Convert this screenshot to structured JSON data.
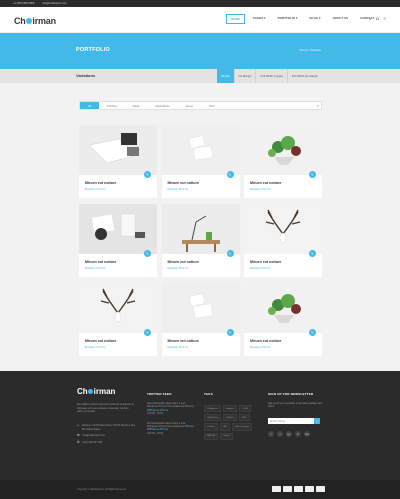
{
  "topbar": {
    "phone": "+1 (567) 890 0909",
    "email": "info@mailexport.com"
  },
  "header": {
    "logo_pre": "Ch",
    "logo_post": "irman",
    "nav": [
      "HOME",
      "PAGES ▾",
      "PORTFOLIO ▾",
      "BLOG ▾",
      "ABOUT US",
      "CONTACT"
    ],
    "icons": [
      "search-icon",
      "cart-icon",
      "menu-icon"
    ]
  },
  "hero": {
    "title": "PORTFOLIO",
    "breadcrumb": "Home  /  Portfolio"
  },
  "subbar": {
    "title": "Variations",
    "tabs": [
      "Simple",
      "No Margin",
      "Full Width Images",
      "Full Width No Margin"
    ]
  },
  "filters": {
    "items": [
      "All",
      "Printing",
      "Ideas",
      "Illustrations",
      "Home",
      "Pcer"
    ],
    "active": 0
  },
  "cards": [
    {
      "title": "Miruen eut notiure",
      "meta": "Branding  /  Print Yer",
      "img": "book"
    },
    {
      "title": "Miruen eut notiure",
      "meta": "Branding  /  Print Yer",
      "img": "cards"
    },
    {
      "title": "Miruen eut notiure",
      "meta": "Branding  /  Print Yer",
      "img": "plants"
    },
    {
      "title": "Miruen eut notiure",
      "meta": "Branding  /  Print Yer",
      "img": "desk"
    },
    {
      "title": "Miruen eut notiure",
      "meta": "Branding  /  Print Yer",
      "img": "lamp"
    },
    {
      "title": "Miruen eut notiure",
      "meta": "Branding  /  Print Yer",
      "img": "antlers"
    },
    {
      "title": "Miruen eut notiure",
      "meta": "Branding  /  Print Yer",
      "img": "antlers"
    },
    {
      "title": "Miruen eut notiure",
      "meta": "Branding  /  Print Yer",
      "img": "cards"
    },
    {
      "title": "Miruen eut notiure",
      "meta": "Branding  /  Print Yer",
      "img": "plants"
    }
  ],
  "footer": {
    "logo_pre": "Ch",
    "logo_post": "irman",
    "about": "Deu adipisi nvenies feaki etem ludus do lecpitenad. In vulputate velit esse molestie consequat, vel illum dolore eu feugiat.",
    "address": "Address : No.66 Sipto Stree/ CS123 Myorfreo City, WL United States",
    "email": "info@mailexport.com",
    "phone": "(101) 900 567 989",
    "col_tweets": "TWITTER FEED",
    "tweets": [
      {
        "text": "Microsoft Ecotific about pibno a new Wordpress Theme Here Attikoumut",
        "link": "#Timony #WPtheme #Theme",
        "date": "JAN 06 - 16:54"
      },
      {
        "text": "Microsoft Ecotific about pibno a new Wordpress Theme Here Attikoumut",
        "link": "#Timony #WPtheme #Theme",
        "date": "JAN 06 - 16:54"
      }
    ],
    "col_tags": "TAGS",
    "tags": [
      "Wordpress",
      "ambient",
      "CSS3",
      "WordPress",
      "HTML5",
      "PHP",
      "winGen",
      "UM",
      "Online Shoppe",
      "MAGPA",
      "Online"
    ],
    "col_news": "SIGN UP FOR NEWSLETTER",
    "news_text": "Sign up for our newsletter to get latest updates and offers.",
    "news_placeholder": "Email address",
    "socials": [
      "f",
      "t",
      "g+",
      "in",
      "rss"
    ],
    "copyright": "Copyright © MainExports. All Rights Reserved.",
    "payments": [
      "visa",
      "mastercard",
      "paypal",
      "amex",
      "discover"
    ]
  }
}
